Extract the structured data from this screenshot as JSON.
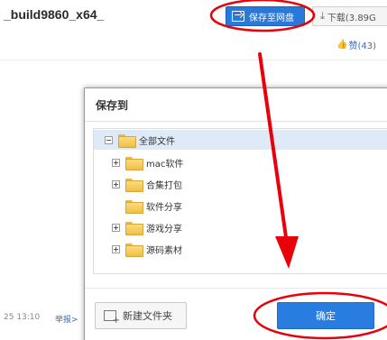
{
  "background": {
    "file_title": "_build9860_x64_",
    "save_to_cloud_label": "保存至网盘",
    "download_label": "下载(3.89G",
    "like_label": "赞(43)",
    "timestamp": "25 13:10",
    "report_label": "举报>"
  },
  "dialog": {
    "title": "保存到",
    "tree": {
      "root_label": "全部文件",
      "items": [
        {
          "label": "mac软件",
          "expandable": true
        },
        {
          "label": "合集打包",
          "expandable": true
        },
        {
          "label": "软件分享",
          "expandable": false
        },
        {
          "label": "游戏分享",
          "expandable": true
        },
        {
          "label": "源码素材",
          "expandable": true
        }
      ]
    },
    "new_folder_label": "新建文件夹",
    "confirm_label": "确定"
  },
  "colors": {
    "primary_blue": "#2a7de0",
    "annotation_red": "#e8000b",
    "folder_yellow": "#f6cd5c",
    "selected_row": "#dfeaf8"
  },
  "icons": {
    "save": "save-to-cloud-icon",
    "download": "download-icon",
    "like": "thumbs-up-icon",
    "folder": "folder-icon",
    "new_folder": "new-folder-icon"
  }
}
